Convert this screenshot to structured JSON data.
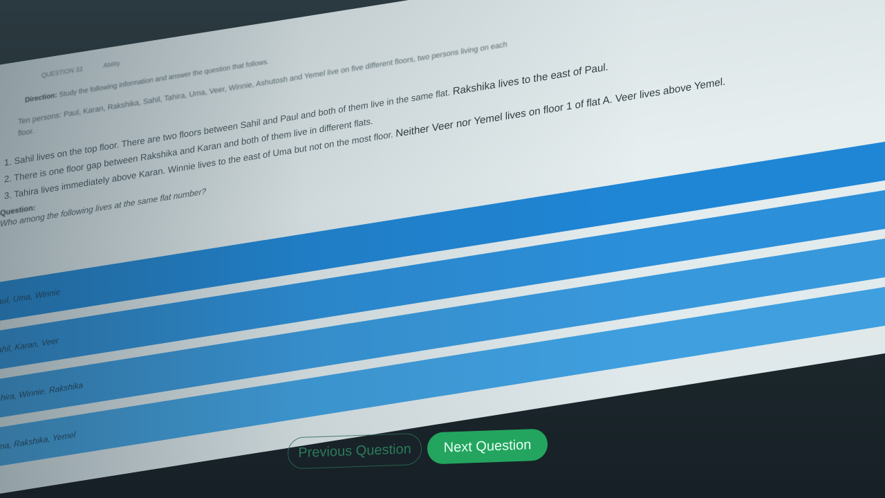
{
  "meta": {
    "question_no": "QUESTION 33",
    "subject": "Ability"
  },
  "direction": {
    "label": "Direction:",
    "text": "Study the following information and answer the question that follows."
  },
  "intro": "Ten persons: Paul, Karan, Rakshika, Sahil, Tahira, Uma, Veer, Winnie, Ashutosh and Yemel live on five different floors, two persons living on each floor.",
  "clues": [
    {
      "near": "1. Sahil lives on the top floor. There are two floors between Sahil and Paul and both of them live in the same flat.",
      "far": "Rakshika lives to the east of Paul."
    },
    {
      "near": "2. There is one floor gap between Rakshika and Karan and both of them live in different flats.",
      "far": ""
    },
    {
      "near": "3. Tahira lives immediately above Karan. Winnie lives to the east of Uma but not on the most floor.",
      "far": "Neither Veer nor Yemel lives on floor 1 of flat A. Veer lives above Yemel."
    }
  ],
  "question": {
    "label": "Question:",
    "text": "Who among the following lives at the same flat number?"
  },
  "options": [
    {
      "text": "Paul, Uma, Winnie"
    },
    {
      "text": "Sahil, Karan, Veer"
    },
    {
      "text": "Tahira, Winnie, Rakshika"
    },
    {
      "text": "Uma, Rakshika, Yemel"
    }
  ],
  "nav": {
    "prev_label": "Previous Question",
    "next_label": "Next Question"
  },
  "colors": {
    "option_bg": "#2a8fd8",
    "next_btn_bg": "#23a55f",
    "prev_btn_border": "#2f6b55"
  }
}
